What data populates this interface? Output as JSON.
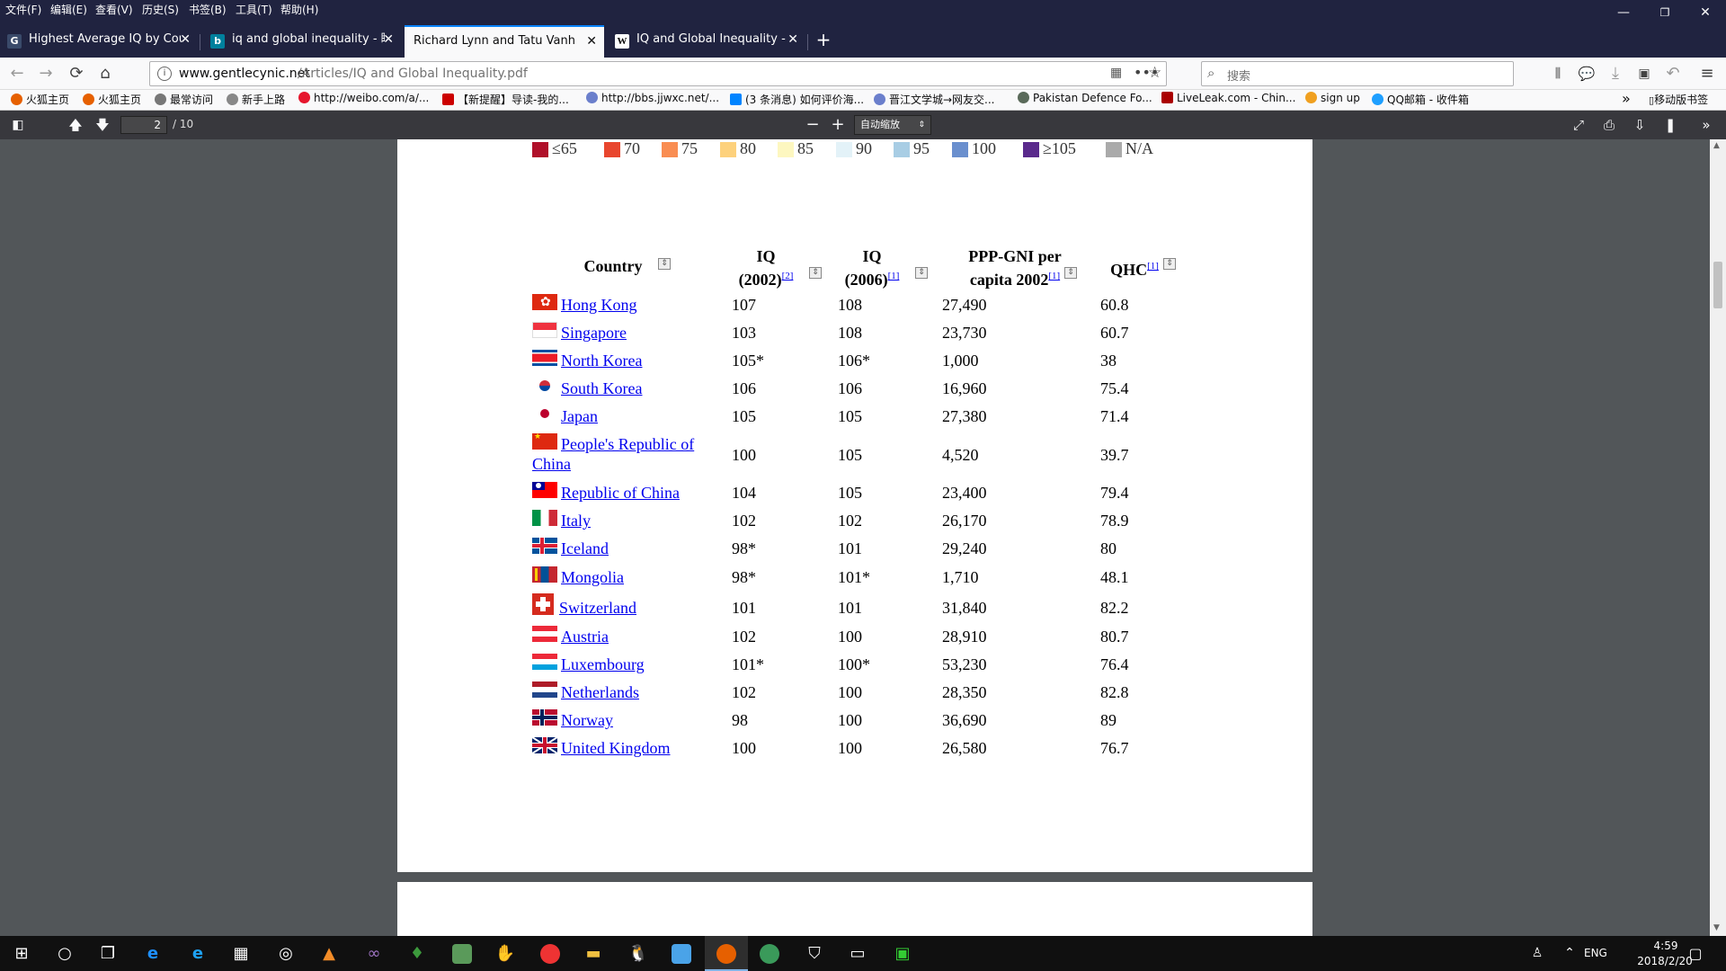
{
  "menu": [
    "文件(F)",
    "编辑(E)",
    "查看(V)",
    "历史(S)",
    "书签(B)",
    "工具(T)",
    "帮助(H)"
  ],
  "window_controls": {
    "minimize": "—",
    "restore": "❐",
    "close": "✕"
  },
  "tabs": [
    {
      "label": "Highest Average IQ by Coun",
      "icon": "G"
    },
    {
      "label": "iq and global inequality - 眼",
      "icon": "b"
    },
    {
      "label": "Richard Lynn and Tatu Vanhanen",
      "icon": ""
    },
    {
      "label": "IQ and Global Inequality - W",
      "icon": "W"
    }
  ],
  "new_tab": "+",
  "address": {
    "url": "www.gentlecynic.net/Articles/IQ and Global Inequality.pdf",
    "host": "www.gentlecynic.net",
    "path": "/Articles/IQ and Global Inequality.pdf"
  },
  "search": {
    "placeholder": "搜索"
  },
  "bookmarks": [
    "火狐主页",
    "火狐主页",
    "最常访问",
    "新手上路",
    "http://weibo.com/a/...",
    "【新提醒】导读-我的...",
    "http://bbs.jjwxc.net/...",
    "(3 条消息) 如何评价海...",
    "晋江文学城→网友交...",
    "Pakistan Defence Fo...",
    "LiveLeak.com - Chin...",
    "sign up",
    "QQ邮箱 - 收件箱"
  ],
  "bookmarks_more": "»",
  "mobile_bookmarks": "移动版书签",
  "pdf": {
    "page": "2",
    "total": "/ 10",
    "zoom": "自动缩放"
  },
  "legend": [
    {
      "label": "≤65",
      "color": "#b0102a"
    },
    {
      "label": "70",
      "color": "#e8462e"
    },
    {
      "label": "75",
      "color": "#f98d52"
    },
    {
      "label": "80",
      "color": "#fdd17c"
    },
    {
      "label": "85",
      "color": "#fdf7c0"
    },
    {
      "label": "90",
      "color": "#e3f2f8"
    },
    {
      "label": "95",
      "color": "#a8cde4"
    },
    {
      "label": "100",
      "color": "#6a8fce"
    },
    {
      "label": "≥105",
      "color": "#5a2a8c"
    },
    {
      "label": "N/A",
      "color": "#aaaaaa"
    }
  ],
  "table": {
    "headers": {
      "country": "Country",
      "iq2002_a": "IQ",
      "iq2002_b": "(2002)",
      "iq2002_ref": "[2]",
      "iq2006_a": "IQ",
      "iq2006_b": "(2006)",
      "iq2006_ref": "[1]",
      "gni_a": "PPP-GNI per",
      "gni_b": "capita 2002",
      "gni_ref": "[1]",
      "qhc": "QHC",
      "qhc_ref": "[1]"
    },
    "rows": [
      {
        "country": "Hong Kong",
        "iq2002": "107",
        "iq2006": "108",
        "gni": "27,490",
        "qhc": "60.8"
      },
      {
        "country": "Singapore",
        "iq2002": "103",
        "iq2006": "108",
        "gni": "23,730",
        "qhc": "60.7"
      },
      {
        "country": "North Korea",
        "iq2002": "105*",
        "iq2006": "106*",
        "gni": "1,000",
        "qhc": "38"
      },
      {
        "country": "South Korea",
        "iq2002": "106",
        "iq2006": "106",
        "gni": "16,960",
        "qhc": "75.4"
      },
      {
        "country": "Japan",
        "iq2002": "105",
        "iq2006": "105",
        "gni": "27,380",
        "qhc": "71.4"
      },
      {
        "country": "People's Republic of",
        "country2": "China",
        "iq2002": "100",
        "iq2006": "105",
        "gni": "4,520",
        "qhc": "39.7"
      },
      {
        "country": "Republic of China",
        "iq2002": "104",
        "iq2006": "105",
        "gni": "23,400",
        "qhc": "79.4"
      },
      {
        "country": "Italy",
        "iq2002": "102",
        "iq2006": "102",
        "gni": "26,170",
        "qhc": "78.9"
      },
      {
        "country": "Iceland",
        "iq2002": "98*",
        "iq2006": "101",
        "gni": "29,240",
        "qhc": "80"
      },
      {
        "country": "Mongolia",
        "iq2002": "98*",
        "iq2006": "101*",
        "gni": "1,710",
        "qhc": "48.1"
      },
      {
        "country": "Switzerland",
        "iq2002": "101",
        "iq2006": "101",
        "gni": "31,840",
        "qhc": "82.2"
      },
      {
        "country": "Austria",
        "iq2002": "102",
        "iq2006": "100",
        "gni": "28,910",
        "qhc": "80.7"
      },
      {
        "country": "Luxembourg",
        "iq2002": "101*",
        "iq2006": "100*",
        "gni": "53,230",
        "qhc": "76.4"
      },
      {
        "country": "Netherlands",
        "iq2002": "102",
        "iq2006": "100",
        "gni": "28,350",
        "qhc": "82.8"
      },
      {
        "country": "Norway",
        "iq2002": "98",
        "iq2006": "100",
        "gni": "36,690",
        "qhc": "89"
      },
      {
        "country": "United Kingdom",
        "iq2002": "100",
        "iq2006": "100",
        "gni": "26,580",
        "qhc": "76.7"
      }
    ]
  },
  "taskbar": {
    "lang": "ENG",
    "time": "4:59",
    "date": "2018/2/20"
  }
}
